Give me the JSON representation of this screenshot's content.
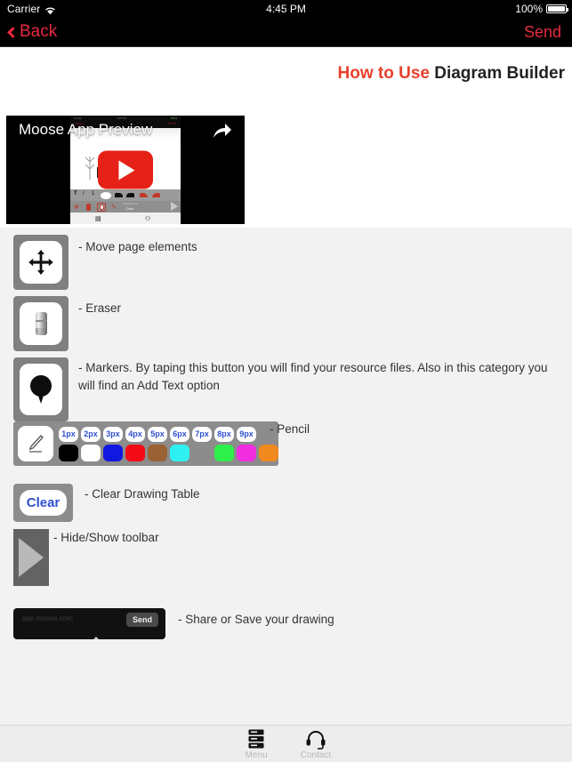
{
  "status_bar": {
    "carrier": "Carrier",
    "wifi_icon": "wifi-icon",
    "time": "4:45 PM",
    "battery_percent": "100%",
    "battery_icon": "battery-full-icon"
  },
  "nav_bar": {
    "back_label": "Back",
    "back_icon": "chevron-left-icon",
    "send_label": "Send",
    "accent_color": "#e8293f"
  },
  "page_title": {
    "highlight": "How to Use",
    "rest": " Diagram Builder",
    "highlight_color": "#e8402c"
  },
  "video": {
    "title": "Moose App Preview",
    "share_icon": "share-arrow-icon",
    "play_icon": "youtube-play-icon",
    "inner_status": {
      "carrier": "Carrier",
      "time": "4:45 PM",
      "battery": "100%",
      "back": "Back",
      "send": "Send"
    },
    "inner_toolbar_labels": {
      "background": "Background",
      "clear": "Clear"
    }
  },
  "instructions": [
    {
      "icon": "move-icon",
      "text": "- Move page elements"
    },
    {
      "icon": "eraser-icon",
      "text": "- Eraser"
    },
    {
      "icon": "marker-pin-icon",
      "text": "- Markers. By taping this button you will find your resource files. Also in this category you will find an Add Text option"
    },
    {
      "icon": "pencil-icon",
      "text": "- Pencil"
    },
    {
      "icon": "clear-button-icon",
      "text": "- Clear Drawing Table"
    },
    {
      "icon": "hide-show-toolbar-icon",
      "text": "- Hide/Show toolbar"
    },
    {
      "icon": "share-bar-icon",
      "text": "- Share or Save your drawing"
    }
  ],
  "pencil_toolbar": {
    "sizes": [
      "1px",
      "2px",
      "3px",
      "4px",
      "5px",
      "6px",
      "7px",
      "8px",
      "9px"
    ],
    "size_text_color": "#2f4fd0",
    "colors": [
      "#000000",
      "#ffffff",
      "#1119e0",
      "#f40b16",
      "#9a6234",
      "#2ef0f0",
      "#8c8c8c",
      "#2ef04a",
      "#f02ee0",
      "#f08a1e"
    ],
    "background_color": "#8c8c8c"
  },
  "clear_button": {
    "label": "Clear",
    "text_color": "#2f4fd0"
  },
  "share_bar": {
    "send_label": "Send",
    "url": "app.moose.com"
  },
  "tab_bar": [
    {
      "icon": "menu-server-icon",
      "label": "Menu"
    },
    {
      "icon": "headset-icon",
      "label": "Contact"
    }
  ]
}
